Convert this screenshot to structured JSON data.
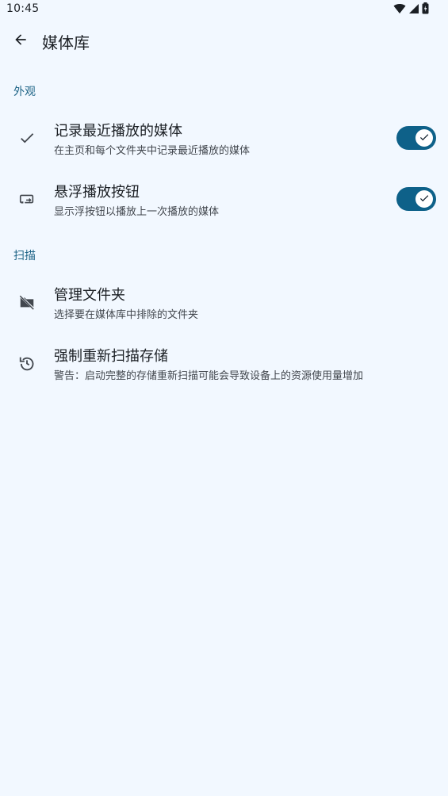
{
  "status_bar": {
    "time": "10:45",
    "icons": [
      "wifi-icon",
      "signal-icon",
      "battery-icon"
    ]
  },
  "app_bar": {
    "back_icon": "arrow-back-icon",
    "title": "媒体库"
  },
  "sections": {
    "appearance": {
      "header": "外观",
      "items": [
        {
          "icon": "check-icon",
          "title": "记录最近播放的媒体",
          "subtitle": "在主页和每个文件夹中记录最近播放的媒体",
          "toggle": true
        },
        {
          "icon": "floating-button-icon",
          "title": "悬浮播放按钮",
          "subtitle": "显示浮按钮以播放上一次播放的媒体",
          "toggle": true
        }
      ]
    },
    "scan": {
      "header": "扫描",
      "items": [
        {
          "icon": "folder-off-icon",
          "title": "管理文件夹",
          "subtitle": "选择要在媒体库中排除的文件夹"
        },
        {
          "icon": "rescan-icon",
          "title": "强制重新扫描存储",
          "subtitle": "警告：启动完整的存储重新扫描可能会导致设备上的资源使用量增加"
        }
      ]
    }
  },
  "colors": {
    "background": "#f2f8ff",
    "accent": "#0e6189",
    "section_header": "#1f6587"
  }
}
